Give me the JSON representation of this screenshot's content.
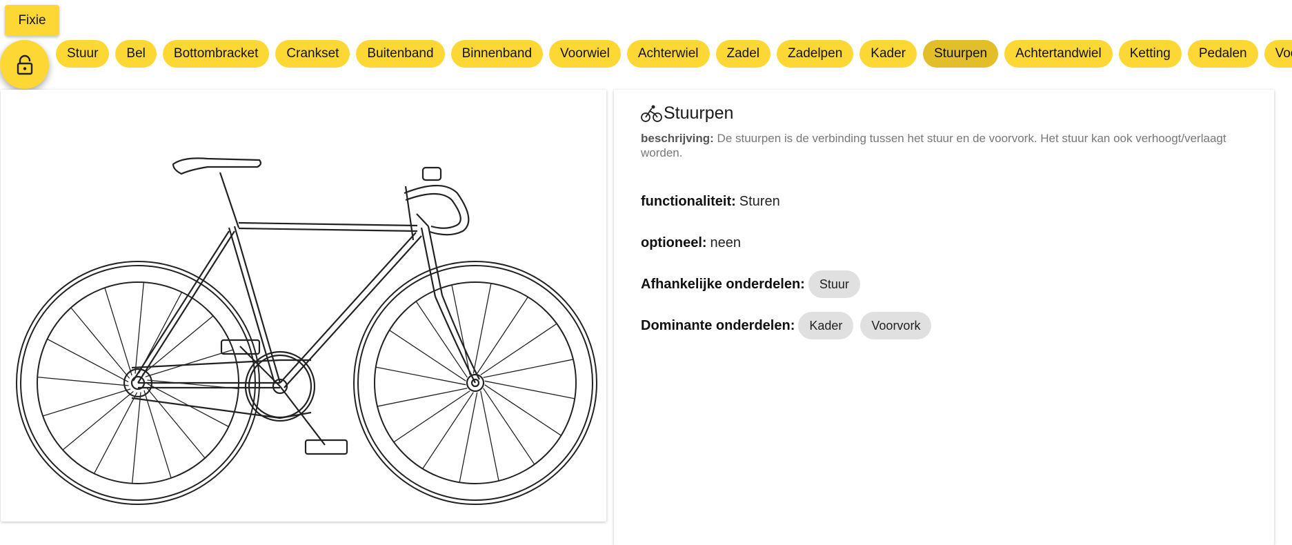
{
  "header": {
    "bike_type_button": "Fixie"
  },
  "parts_chips": [
    "Stuur",
    "Bel",
    "Bottombracket",
    "Crankset",
    "Buitenband",
    "Binnenband",
    "Voorwiel",
    "Achterwiel",
    "Zadel",
    "Zadelpen",
    "Kader",
    "Stuurpen",
    "Achtertandwiel",
    "Ketting",
    "Pedalen",
    "Voorvork"
  ],
  "selected_part": "Stuurpen",
  "detail": {
    "title": "Stuurpen",
    "description_label": "beschrijving:",
    "description_text": "De stuurpen is de verbinding tussen het stuur en de voorvork. Het stuur kan ook verhoogt/verlaagt worden.",
    "functionality_label": "functionaliteit:",
    "functionality_value": "Sturen",
    "optional_label": "optioneel:",
    "optional_value": "neen",
    "dependent_label": "Afhankelijke onderdelen:",
    "dependent_parts": [
      "Stuur"
    ],
    "dominant_label": "Dominante onderdelen:",
    "dominant_parts": [
      "Kader",
      "Voorvork"
    ]
  },
  "colors": {
    "accent": "#fdd835",
    "accent_active": "#e2bf2a",
    "pill_grey": "#e0e0e0"
  },
  "icons": {
    "lock": "lock-icon",
    "bike": "bicycle-icon"
  }
}
